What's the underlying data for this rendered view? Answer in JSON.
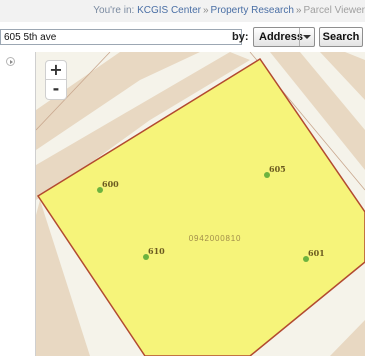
{
  "breadcrumb": {
    "prefix": "You're in:",
    "items": [
      "KCGIS Center",
      "Property Research",
      "Parcel Viewer"
    ],
    "separator": "»"
  },
  "search": {
    "value": "605 5th ave",
    "by_label": "by:",
    "type_selected": "Address",
    "button_label": "Search"
  },
  "map": {
    "zoom_in": "+",
    "zoom_out": "-",
    "parcel_id": "0942000810",
    "address_points": [
      {
        "label": "600"
      },
      {
        "label": "605"
      },
      {
        "label": "610"
      },
      {
        "label": "601"
      }
    ]
  },
  "colors": {
    "parcel_fill": "#f6f47a",
    "parcel_outline": "#b24a30",
    "lot_fill": "#e8d8c2",
    "road": "#f5f3ea",
    "point": "#6cb33f",
    "label": "#6b5a20"
  }
}
